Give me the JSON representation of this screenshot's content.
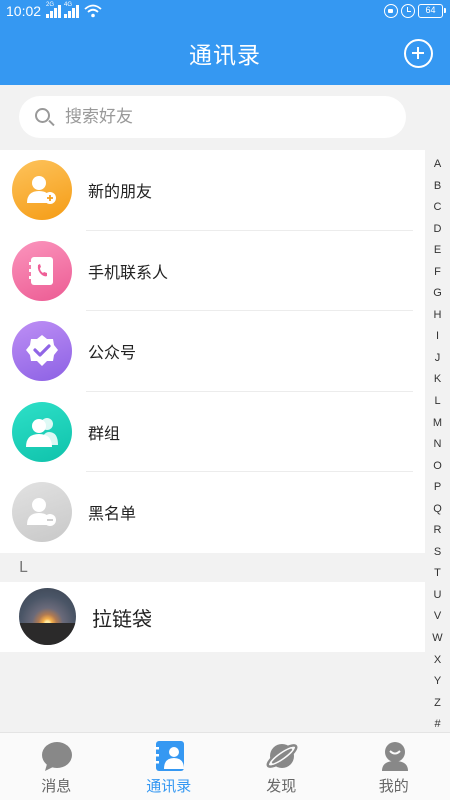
{
  "status_bar": {
    "time": "10:02",
    "net1": "2G",
    "net2": "4G",
    "battery": "64"
  },
  "header": {
    "title": "通讯录"
  },
  "search": {
    "placeholder": "搜索好友"
  },
  "menu": [
    {
      "label": "新的朋友",
      "icon": "add-friend-icon",
      "color_from": "#fdb64b",
      "color_to": "#f7a01e"
    },
    {
      "label": "手机联系人",
      "icon": "phone-contacts-icon",
      "color_from": "#f98bb6",
      "color_to": "#ef5f97"
    },
    {
      "label": "公众号",
      "icon": "verified-badge-icon",
      "color_from": "#b585f2",
      "color_to": "#9065e6"
    },
    {
      "label": "群组",
      "icon": "group-icon",
      "color_from": "#22d8c1",
      "color_to": "#12c7b0"
    },
    {
      "label": "黑名单",
      "icon": "blacklist-icon",
      "color_from": "#dcdcdc",
      "color_to": "#c9c9c9"
    }
  ],
  "contacts_section": {
    "letter": "L"
  },
  "contacts": [
    {
      "name": "拉链袋"
    }
  ],
  "alphabet": [
    "A",
    "B",
    "C",
    "D",
    "E",
    "F",
    "G",
    "H",
    "I",
    "J",
    "K",
    "L",
    "M",
    "N",
    "O",
    "P",
    "Q",
    "R",
    "S",
    "T",
    "U",
    "V",
    "W",
    "X",
    "Y",
    "Z",
    "#"
  ],
  "tabs": [
    {
      "label": "消息",
      "icon": "chat-bubble-icon",
      "active": false
    },
    {
      "label": "通讯录",
      "icon": "contacts-book-icon",
      "active": true
    },
    {
      "label": "发现",
      "icon": "planet-icon",
      "active": false
    },
    {
      "label": "我的",
      "icon": "person-icon",
      "active": false
    }
  ],
  "colors": {
    "primary": "#3598f2",
    "inactive_icon": "#888888",
    "background": "#f2f2f2"
  }
}
